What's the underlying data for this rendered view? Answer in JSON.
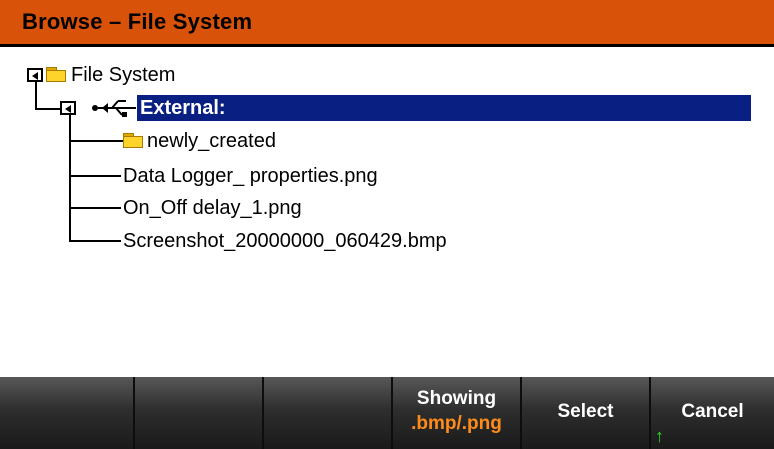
{
  "window": {
    "title": "Browse – File System"
  },
  "tree": {
    "root": {
      "label": "File System",
      "icon": "folder-icon"
    },
    "device": {
      "label": "External:",
      "icon": "usb-icon",
      "selected": true
    },
    "children": [
      {
        "label": "newly_created",
        "type": "folder"
      },
      {
        "label": "Data Logger_ properties.png",
        "type": "file"
      },
      {
        "label": "On_Off delay_1.png",
        "type": "file"
      },
      {
        "label": "Screenshot_20000000_060429.bmp",
        "type": "file"
      }
    ]
  },
  "softkeys": {
    "key1": "",
    "key2": "",
    "key3": "",
    "showing": {
      "label": "Showing",
      "value": ".bmp/.png"
    },
    "select": "Select",
    "cancel": "Cancel"
  },
  "colors": {
    "title_bar": "#d9520a",
    "selection": "#0a1f82",
    "softkey_value": "#ff8c1a",
    "arrow": "#2fdc2f"
  }
}
